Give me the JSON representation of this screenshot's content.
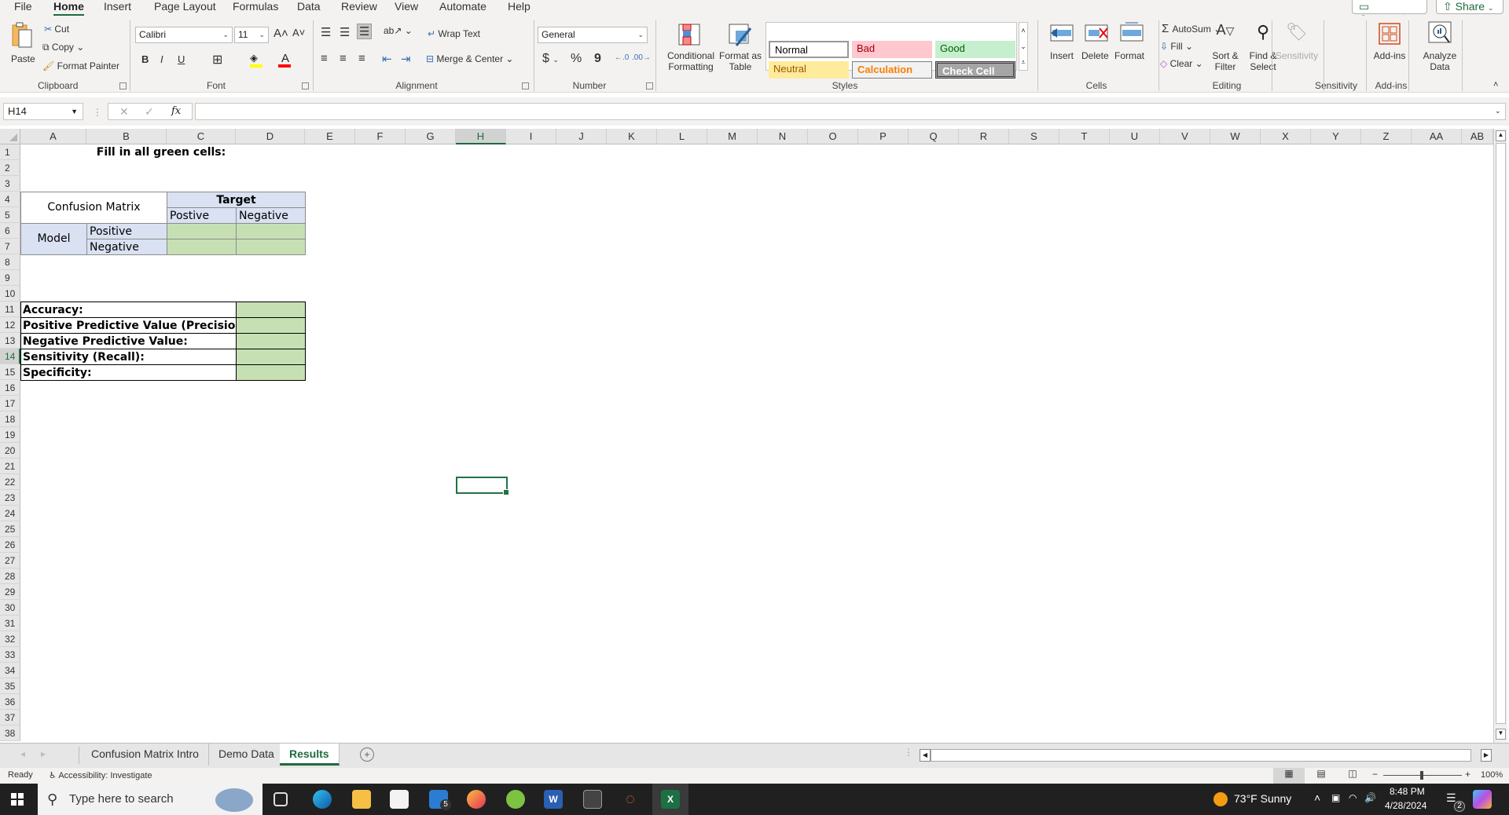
{
  "menu": {
    "tabs": [
      "File",
      "Home",
      "Insert",
      "Page Layout",
      "Formulas",
      "Data",
      "Review",
      "View",
      "Automate",
      "Help"
    ],
    "active_tab": "Home",
    "comments_label": "Comments",
    "share_label": "Share"
  },
  "ribbon": {
    "clipboard": {
      "paste": "Paste",
      "cut": "Cut",
      "copy": "Copy",
      "format_painter": "Format Painter",
      "label": "Clipboard"
    },
    "font": {
      "name": "Calibri",
      "size": "11",
      "label": "Font",
      "bold": "B",
      "italic": "I",
      "underline": "U"
    },
    "alignment": {
      "wrap_text": "Wrap Text",
      "merge_center": "Merge & Center",
      "label": "Alignment"
    },
    "number": {
      "format": "General",
      "currency": "$",
      "percent": "%",
      "comma": "9",
      "label": "Number"
    },
    "styles": {
      "conditional_formatting": [
        "Conditional",
        "Formatting"
      ],
      "format_as_table": [
        "Format as",
        "Table"
      ],
      "cells": [
        {
          "name": "Normal",
          "bg": "#ffffff",
          "fg": "#000000"
        },
        {
          "name": "Bad",
          "bg": "#ffc7ce",
          "fg": "#9c0006"
        },
        {
          "name": "Good",
          "bg": "#c6efce",
          "fg": "#006100"
        },
        {
          "name": "Neutral",
          "bg": "#ffeb9c",
          "fg": "#9c5700"
        },
        {
          "name": "Calculation",
          "bg": "#f2f2f2",
          "fg": "#fa7d00"
        },
        {
          "name": "Check Cell",
          "bg": "#a5a5a5",
          "fg": "#ffffff"
        }
      ],
      "label": "Styles"
    },
    "cells": {
      "insert": "Insert",
      "delete": "Delete",
      "format": "Format",
      "label": "Cells"
    },
    "editing": {
      "autosum": "AutoSum",
      "fill": "Fill",
      "clear": "Clear",
      "sort_filter": [
        "Sort &",
        "Filter"
      ],
      "find_select": [
        "Find &",
        "Select"
      ],
      "label": "Editing"
    },
    "sensitivity": {
      "button": "Sensitivity",
      "label": "Sensitivity"
    },
    "addins": {
      "button": "Add-ins",
      "label": "Add-ins"
    },
    "analyze": {
      "button": [
        "Analyze",
        "Data"
      ]
    }
  },
  "formula_bar": {
    "name_box": "H14",
    "fx": "fx",
    "formula": ""
  },
  "columns": [
    "A",
    "B",
    "C",
    "D",
    "E",
    "F",
    "G",
    "H",
    "I",
    "J",
    "K",
    "L",
    "M",
    "N",
    "O",
    "P",
    "Q",
    "R",
    "S",
    "T",
    "U",
    "V",
    "W",
    "X",
    "Y",
    "Z",
    "AA",
    "AB"
  ],
  "selected_column": "H",
  "selected_row": 14,
  "rows": 38,
  "sheet": {
    "instruction": "Fill in all green cells:",
    "matrix_title": "Confusion Matrix",
    "target_label": "Target",
    "target_pos": "Postive",
    "target_neg": "Negative",
    "model_label": "Model",
    "model_pos": "Positive",
    "model_neg": "Negative",
    "metrics": [
      "Accuracy:",
      "Positive Predictive Value (Precision):",
      "Negative Predictive Value:",
      "Sensitivity (Recall):",
      "Specificity:"
    ]
  },
  "sheet_tabs": [
    "Confusion Matrix Intro",
    "Demo Data",
    "Results"
  ],
  "active_sheet": "Results",
  "status": {
    "ready": "Ready",
    "accessibility": "Accessibility: Investigate",
    "zoom": "100%"
  },
  "taskbar": {
    "search_placeholder": "Type here to search",
    "mail_badge": "5",
    "weather": "73°F  Sunny",
    "time": "8:48 PM",
    "date": "4/28/2024",
    "notif_badge": "2"
  }
}
